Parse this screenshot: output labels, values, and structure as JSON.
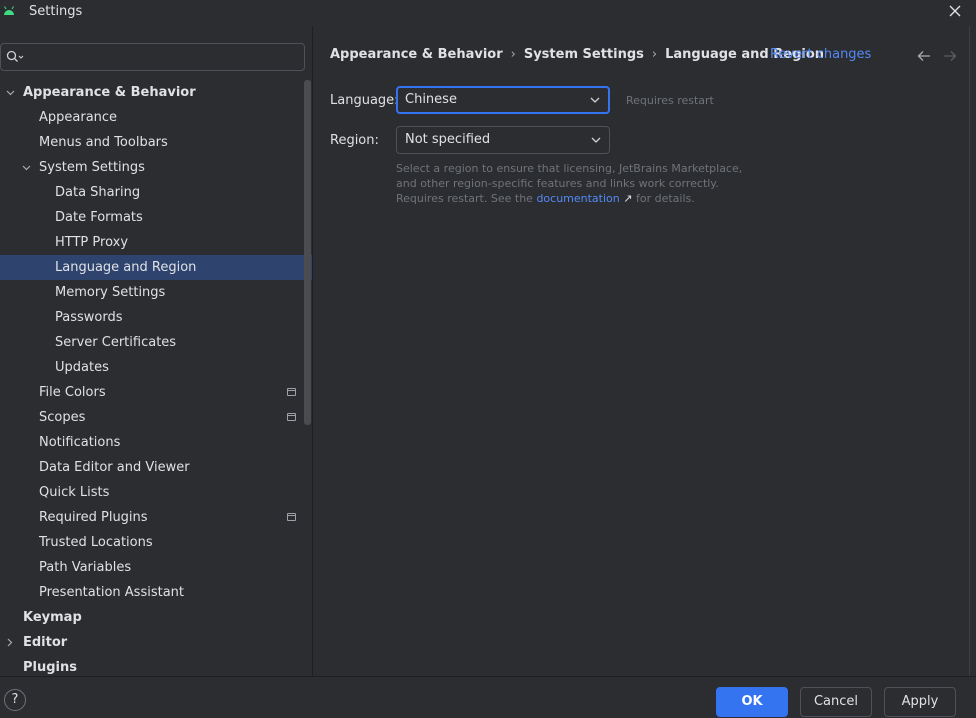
{
  "window": {
    "title": "Settings"
  },
  "search": {
    "placeholder": ""
  },
  "sidebar": {
    "items": [
      {
        "label": "Appearance & Behavior",
        "level": 0,
        "expanded": true,
        "bold": true,
        "selected": false,
        "project_icon": false,
        "has_children": true
      },
      {
        "label": "Appearance",
        "level": 1,
        "bold": false,
        "selected": false,
        "project_icon": false,
        "has_children": false
      },
      {
        "label": "Menus and Toolbars",
        "level": 1,
        "bold": false,
        "selected": false,
        "project_icon": false,
        "has_children": false
      },
      {
        "label": "System Settings",
        "level": 1,
        "expanded": true,
        "bold": false,
        "selected": false,
        "project_icon": false,
        "has_children": true
      },
      {
        "label": "Data Sharing",
        "level": 2,
        "bold": false,
        "selected": false,
        "project_icon": false,
        "has_children": false
      },
      {
        "label": "Date Formats",
        "level": 2,
        "bold": false,
        "selected": false,
        "project_icon": false,
        "has_children": false
      },
      {
        "label": "HTTP Proxy",
        "level": 2,
        "bold": false,
        "selected": false,
        "project_icon": false,
        "has_children": false
      },
      {
        "label": "Language and Region",
        "level": 2,
        "bold": false,
        "selected": true,
        "project_icon": false,
        "has_children": false
      },
      {
        "label": "Memory Settings",
        "level": 2,
        "bold": false,
        "selected": false,
        "project_icon": false,
        "has_children": false
      },
      {
        "label": "Passwords",
        "level": 2,
        "bold": false,
        "selected": false,
        "project_icon": false,
        "has_children": false
      },
      {
        "label": "Server Certificates",
        "level": 2,
        "bold": false,
        "selected": false,
        "project_icon": false,
        "has_children": false
      },
      {
        "label": "Updates",
        "level": 2,
        "bold": false,
        "selected": false,
        "project_icon": false,
        "has_children": false
      },
      {
        "label": "File Colors",
        "level": 1,
        "bold": false,
        "selected": false,
        "project_icon": true,
        "has_children": false
      },
      {
        "label": "Scopes",
        "level": 1,
        "bold": false,
        "selected": false,
        "project_icon": true,
        "has_children": false
      },
      {
        "label": "Notifications",
        "level": 1,
        "bold": false,
        "selected": false,
        "project_icon": false,
        "has_children": false
      },
      {
        "label": "Data Editor and Viewer",
        "level": 1,
        "bold": false,
        "selected": false,
        "project_icon": false,
        "has_children": false
      },
      {
        "label": "Quick Lists",
        "level": 1,
        "bold": false,
        "selected": false,
        "project_icon": false,
        "has_children": false
      },
      {
        "label": "Required Plugins",
        "level": 1,
        "bold": false,
        "selected": false,
        "project_icon": true,
        "has_children": false
      },
      {
        "label": "Trusted Locations",
        "level": 1,
        "bold": false,
        "selected": false,
        "project_icon": false,
        "has_children": false
      },
      {
        "label": "Path Variables",
        "level": 1,
        "bold": false,
        "selected": false,
        "project_icon": false,
        "has_children": false
      },
      {
        "label": "Presentation Assistant",
        "level": 1,
        "bold": false,
        "selected": false,
        "project_icon": false,
        "has_children": false
      },
      {
        "label": "Keymap",
        "level": 0,
        "bold": true,
        "selected": false,
        "project_icon": false,
        "has_children": false
      },
      {
        "label": "Editor",
        "level": 0,
        "expanded": false,
        "bold": true,
        "selected": false,
        "project_icon": false,
        "has_children": true
      },
      {
        "label": "Plugins",
        "level": 0,
        "bold": true,
        "selected": false,
        "project_icon": false,
        "has_children": false
      }
    ]
  },
  "breadcrumb": {
    "items": [
      "Appearance & Behavior",
      "System Settings",
      "Language and Region"
    ],
    "separator": "›"
  },
  "header": {
    "revert_label": "Revert changes"
  },
  "form": {
    "language": {
      "label": "Language:",
      "value": "Chinese",
      "hint": "Requires restart"
    },
    "region": {
      "label": "Region:",
      "value": "Not specified",
      "description_before": "Select a region to ensure that licensing, JetBrains Marketplace, and other region-specific features and links work correctly. Requires restart. See the",
      "link_label": "documentation",
      "link_arrow": "↗",
      "description_after": "for details."
    }
  },
  "footer": {
    "help_label": "?",
    "ok_label": "OK",
    "cancel_label": "Cancel",
    "apply_label": "Apply"
  },
  "colors": {
    "background": "#2b2d30",
    "selection": "#2e436e",
    "accent": "#3574f0",
    "link": "#548af7",
    "android_icon": "#3ddc84"
  },
  "icons": {
    "app": "android-icon",
    "close": "close-icon",
    "search": "search-icon",
    "back": "arrow-left-icon",
    "forward": "arrow-right-icon",
    "project": "project-scope-icon",
    "expand": "chevron-down-icon",
    "collapse": "chevron-right-icon",
    "dropdown": "chevron-down-icon"
  }
}
